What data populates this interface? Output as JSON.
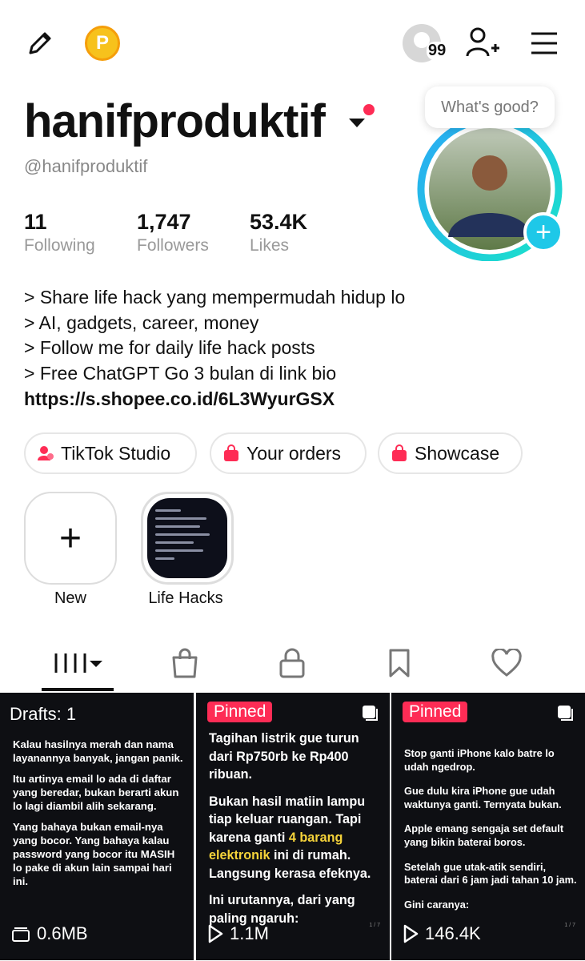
{
  "header": {
    "coin_letter": "P",
    "notification_count": "99",
    "icons": [
      "pencil-icon",
      "points-coin-icon",
      "add-user-icon",
      "menu-icon"
    ]
  },
  "profile": {
    "username": "hanifproduktif",
    "handle": "@hanifproduktif",
    "tooltip": "What's good?",
    "stats": [
      {
        "value": "11",
        "label": "Following"
      },
      {
        "value": "1,747",
        "label": "Followers"
      },
      {
        "value": "53.4K",
        "label": "Likes"
      }
    ],
    "bio": [
      "> Share life hack yang mempermudah hidup lo",
      "> AI, gadgets, career, money",
      "> Follow me for daily life hack posts",
      "> Free ChatGPT Go 3 bulan di link bio"
    ],
    "link": "https://s.shopee.co.id/6L3WyurGSX"
  },
  "actions": [
    {
      "label": "TikTok Studio",
      "icon": "tiktok-studio-icon"
    },
    {
      "label": "Your orders",
      "icon": "shopping-bag-icon"
    },
    {
      "label": "Showcase",
      "icon": "showcase-bag-icon"
    }
  ],
  "stories": [
    {
      "label": "New"
    },
    {
      "label": "Life Hacks"
    }
  ],
  "tabs": [
    "videos-grid-icon",
    "shop-bag-icon",
    "private-lock-icon",
    "saved-bookmark-icon",
    "liked-heart-icon"
  ],
  "colors": {
    "accent": "#fe2c55",
    "ring": "#1ec8e8",
    "highlight": "#f5d33a",
    "coin": "#f7c21c"
  },
  "grid": [
    {
      "label": "Drafts: 1",
      "paragraphs": [
        "Kalau hasilnya merah dan nama layanannya banyak, jangan panik.",
        "Itu artinya email lo ada di daftar yang beredar, bukan berarti akun lo lagi diambil alih sekarang.",
        "Yang bahaya bukan email-nya yang bocor. Yang bahaya kalau password yang bocor itu MASIH lo pake di akun lain sampai hari ini."
      ],
      "metric": "0.6MB"
    },
    {
      "label": "Pinned",
      "paragraphs": [
        "Tagihan listrik gue turun dari Rp750rb ke Rp400 ribuan.",
        "Bukan hasil matiin lampu tiap keluar ruangan. Tapi karena ganti",
        "4 barang elektronik",
        "ini di rumah. Langsung kerasa efeknya.",
        "Ini urutannya, dari yang paling ngaruh:"
      ],
      "metric": "1.1M",
      "page": "1 / 7"
    },
    {
      "label": "Pinned",
      "paragraphs": [
        "Stop ganti iPhone kalo batre lo udah ngedrop.",
        "Gue dulu kira iPhone gue udah waktunya ganti. Ternyata bukan.",
        "Apple emang sengaja set default yang bikin baterai boros.",
        "Setelah gue utak-atik sendiri, baterai dari 6 jam jadi tahan 10 jam.",
        "Gini caranya:"
      ],
      "metric": "146.4K",
      "page": "1 / 7"
    }
  ]
}
